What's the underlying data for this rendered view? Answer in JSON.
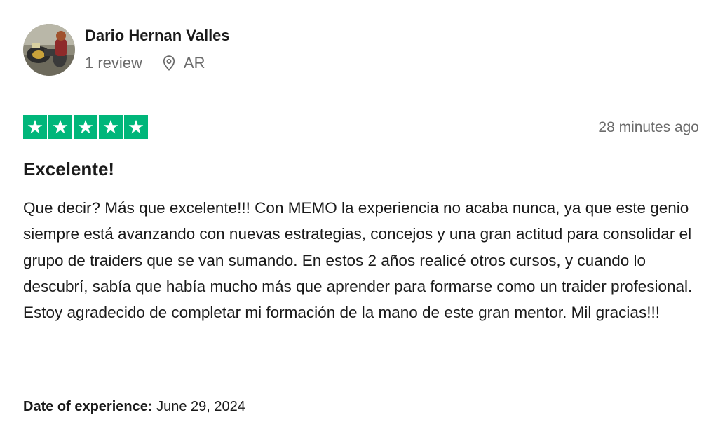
{
  "reviewer": {
    "name": "Dario Hernan Valles",
    "review_count": "1 review",
    "location_icon": "location-pin-icon",
    "country": "AR"
  },
  "rating": {
    "stars": 5,
    "out_of": 5,
    "color": "#00b67a"
  },
  "time_ago": "28 minutes ago",
  "review": {
    "title": "Excelente!",
    "body": "Que decir? Más que excelente!!! Con MEMO la experiencia no acaba nunca, ya que este genio siempre está avanzando con nuevas estrategias, concejos y una gran actitud para consolidar el grupo de traiders que se van sumando. En estos 2 años realicé otros cursos, y cuando lo descubrí, sabía que había mucho más que aprender para formarse como un traider profesional. Estoy agradecido de completar mi formación de la mano de este gran mentor. Mil gracias!!!"
  },
  "experience": {
    "label": "Date of experience:",
    "date": "June 29, 2024"
  }
}
